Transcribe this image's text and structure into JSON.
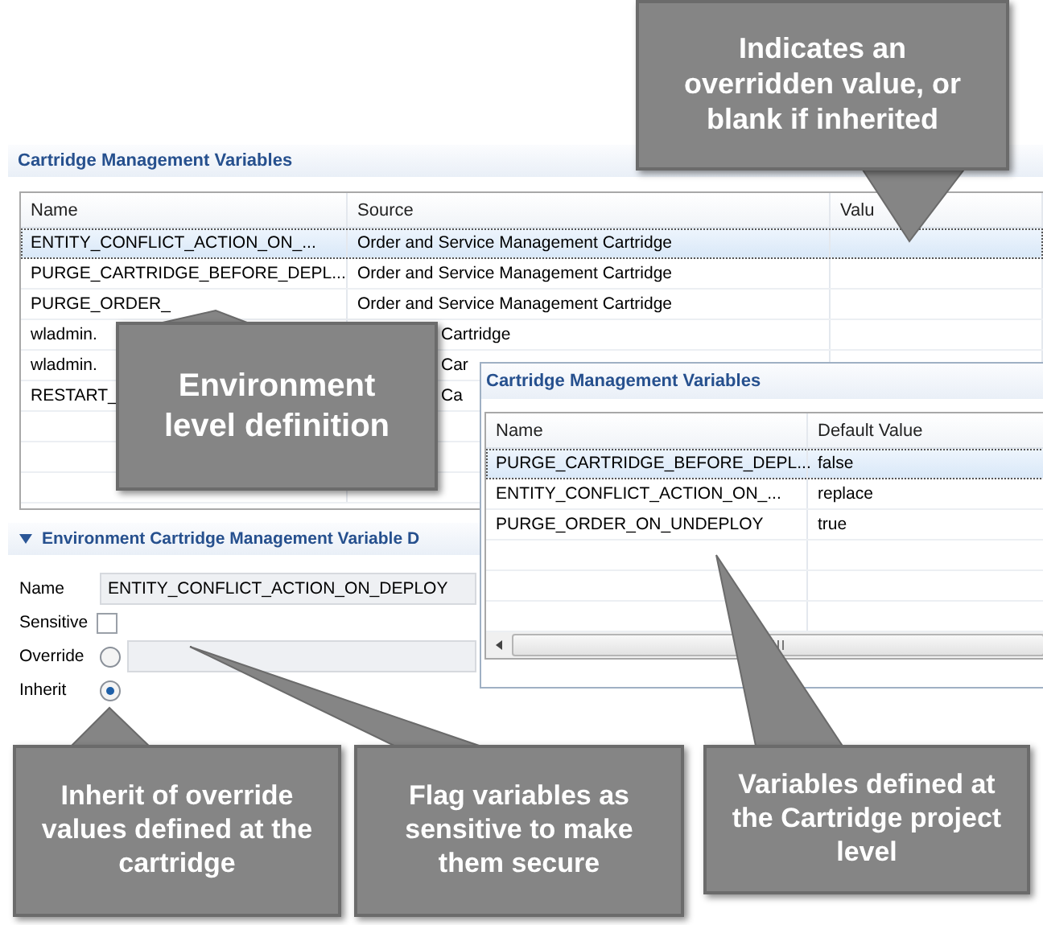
{
  "main_panel": {
    "title": "Cartridge Management Variables",
    "columns": [
      "Name",
      "Source",
      "Valu"
    ],
    "rows": [
      {
        "name": "ENTITY_CONFLICT_ACTION_ON_...",
        "source": "Order and Service Management Cartridge",
        "selected": true,
        "covered": false
      },
      {
        "name": "PURGE_CARTRIDGE_BEFORE_DEPL...",
        "source": "Order and Service Management Cartridge",
        "selected": false,
        "covered": false
      },
      {
        "name": "PURGE_ORDER_",
        "source": "Order and Service Management Cartridge",
        "selected": false,
        "covered": false
      },
      {
        "name": "wladmin.",
        "source": "Cartridge",
        "selected": false,
        "covered": true
      },
      {
        "name": "wladmin.",
        "source": "Car",
        "selected": false,
        "covered": true
      },
      {
        "name": "RESTART_",
        "source": "Ca",
        "selected": false,
        "covered": true
      }
    ]
  },
  "details": {
    "title": "Environment Cartridge Management Variable D",
    "expanded": true,
    "name_label": "Name",
    "name_value": "ENTITY_CONFLICT_ACTION_ON_DEPLOY",
    "sensitive_label": "Sensitive",
    "sensitive_checked": false,
    "options": [
      {
        "label": "Override",
        "selected": false,
        "kind": "field"
      },
      {
        "label": "Inherit",
        "selected": true,
        "kind": "plain"
      }
    ]
  },
  "cartridge_panel": {
    "title": "Cartridge Management Variables",
    "columns": [
      "Name",
      "Default Value"
    ],
    "rows": [
      {
        "name": "PURGE_CARTRIDGE_BEFORE_DEPL...",
        "value": "false",
        "selected": true
      },
      {
        "name": "ENTITY_CONFLICT_ACTION_ON_...",
        "value": "replace",
        "selected": false
      },
      {
        "name": "PURGE_ORDER_ON_UNDEPLOY",
        "value": "true",
        "selected": false
      }
    ]
  },
  "callouts": [
    {
      "text": "Indicates an overridden value, or blank if inherited"
    },
    {
      "text": "Environment level definition"
    },
    {
      "text": "Inherit of override values defined at the cartridge"
    },
    {
      "text": "Flag variables as sensitive to make them secure"
    },
    {
      "text": "Variables defined at the Cartridge project level"
    }
  ]
}
